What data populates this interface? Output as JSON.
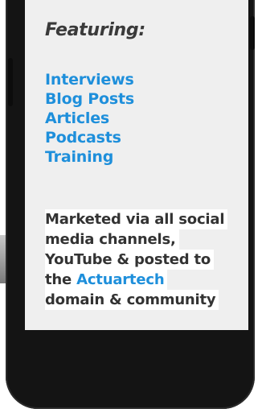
{
  "screen": {
    "heading": "Featuring:",
    "items": [
      "Interviews",
      "Blog Posts",
      "Articles",
      "Podcasts",
      "Training"
    ],
    "description": {
      "line1": "Marketed via all social",
      "line2": "media channels,",
      "line3": "YouTube  & posted to",
      "line4_prefix": "the ",
      "line4_accent": "Actuartech",
      "line5": "domain & community"
    }
  },
  "colors": {
    "accent": "#1e8fdb",
    "text": "#333333",
    "phone_body": "#141414",
    "screen_bg": "#efefef"
  }
}
